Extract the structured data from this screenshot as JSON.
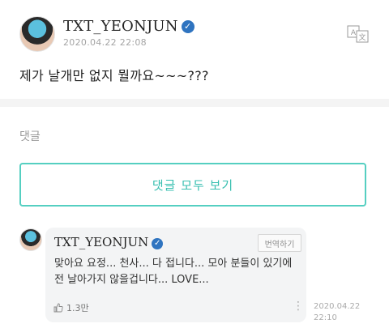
{
  "post": {
    "author": "TXT_YEONJUN",
    "date": "2020.04.22 22:08",
    "body": "제가 날개만 없지 뭘까요~~~???",
    "translate_icon_a": "A",
    "translate_icon_b": "文"
  },
  "comments": {
    "section_label": "댓글",
    "view_all_label": "댓글 모두 보기",
    "items": [
      {
        "author": "TXT_YEONJUN",
        "translate_label": "번역하기",
        "text": "맞아요 요정... 천사... 다 접니다... 모아 분들이 있기에 전 날아가지 않을겁니다... LOVE...",
        "likes": "1.3만",
        "time_date": "2020.04.22",
        "time_clock": "22:10"
      }
    ]
  },
  "icons": {
    "verified": "verified-badge-icon",
    "translate": "translate-icon",
    "like": "thumbs-up-icon",
    "more": "more-vertical-icon"
  },
  "colors": {
    "accent": "#37bfb0",
    "verified": "#2f74c0",
    "bubble": "#f3f4f5"
  }
}
